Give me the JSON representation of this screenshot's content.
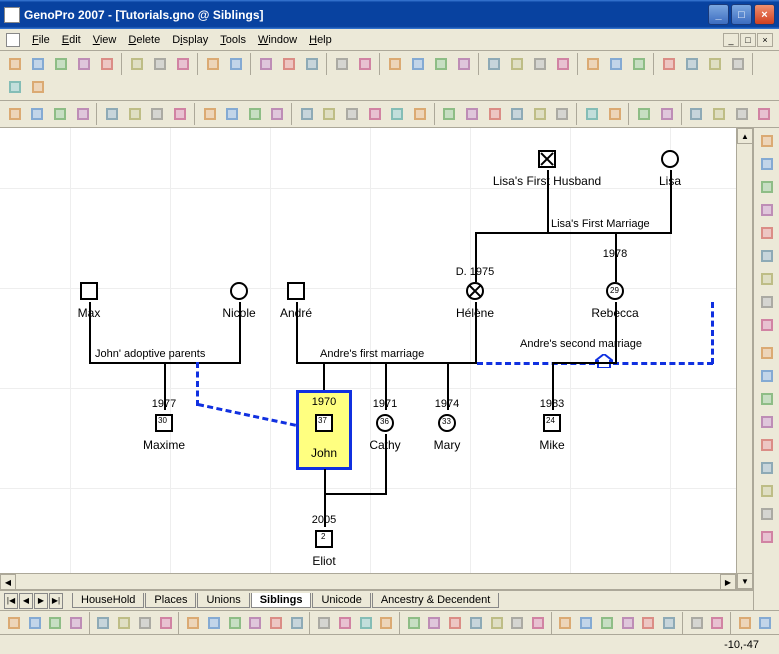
{
  "window": {
    "title": "GenoPro 2007 - [Tutorials.gno @ Siblings]"
  },
  "menu": {
    "items": [
      "File",
      "Edit",
      "View",
      "Delete",
      "Display",
      "Tools",
      "Window",
      "Help"
    ]
  },
  "tabs": {
    "items": [
      "HouseHold",
      "Places",
      "Unions",
      "Siblings",
      "Unicode",
      "Ancestry & Decendent"
    ],
    "active": "Siblings"
  },
  "status": {
    "coords": "-10,-47"
  },
  "people": {
    "lisa_husband": {
      "name": "Lisa's First Husband"
    },
    "lisa": {
      "name": "Lisa"
    },
    "helene": {
      "name": "Hélène",
      "death": "D. 1975"
    },
    "rebecca": {
      "name": "Rebecca",
      "age": "29"
    },
    "max": {
      "name": "Max"
    },
    "nicole": {
      "name": "Nicole"
    },
    "andre": {
      "name": "André"
    },
    "maxime": {
      "name": "Maxime",
      "year": "1977",
      "age": "30"
    },
    "john": {
      "name": "John",
      "year": "1970",
      "age": "37"
    },
    "cathy": {
      "name": "Cathy",
      "year": "1971",
      "age": "36"
    },
    "mary": {
      "name": "Mary",
      "year": "1974",
      "age": "33"
    },
    "mike": {
      "name": "Mike",
      "year": "1983",
      "age": "24"
    },
    "eliot": {
      "name": "Eliot",
      "year": "2005",
      "age": "2"
    }
  },
  "relationships": {
    "lisa_marriage": {
      "label": "Lisa's First Marriage",
      "year": "1978"
    },
    "john_adoptive": {
      "label": "John' adoptive parents"
    },
    "andre_first": {
      "label": "Andre's first marriage"
    },
    "andre_second": {
      "label": "Andre's second marriage"
    }
  },
  "toolbar_icons": [
    "new",
    "open",
    "save",
    "print",
    "print-preview",
    "",
    "cut",
    "copy",
    "paste",
    "",
    "undo",
    "redo",
    "",
    "grid",
    "snap",
    "layers",
    "",
    "zoom-fit",
    "mag",
    "",
    "person-m",
    "person-f",
    "link",
    "chain",
    "",
    "h1",
    "h2",
    "h3",
    "h4",
    "",
    "bolt",
    "tool1",
    "tool2",
    "",
    "text",
    "marker",
    "color",
    "circle",
    "",
    "gear",
    "help"
  ],
  "toolbar2_icons": [
    "nav1",
    "nav2",
    "left",
    "right",
    "",
    "grid1",
    "grid2",
    "grid3",
    "grid4",
    "",
    "zoom-out",
    "zoom-in",
    "zoom-sel",
    "zoom-all",
    "",
    "t1",
    "t2",
    "t3",
    "t4",
    "t5",
    "t6",
    "",
    "t7",
    "t8",
    "t9",
    "t10",
    "t11",
    "t12",
    "",
    "c1",
    "c2",
    "",
    "font-a",
    "font-b",
    "",
    "sw1",
    "sw2",
    "smiley",
    "sw3"
  ],
  "vtoolbar_icons": [
    "v1",
    "v2",
    "v3",
    "v4",
    "v5",
    "v6",
    "v7",
    "v8",
    "v9",
    "",
    "v10",
    "v11",
    "v12",
    "v13",
    "v14",
    "v15",
    "v16",
    "v17",
    "v18"
  ],
  "bottom_icons": [
    "b1",
    "b2",
    "b3",
    "b4",
    "",
    "b5",
    "b6",
    "b7",
    "b8",
    "",
    "b9",
    "b10",
    "b11",
    "b12",
    "b13",
    "b14",
    "",
    "b15",
    "b16",
    "b17",
    "b18",
    "",
    "b19",
    "b20",
    "b21",
    "b22",
    "b23",
    "b24",
    "b25",
    "",
    "b26",
    "b27",
    "b28",
    "b29",
    "b30",
    "b31",
    "",
    "b32",
    "b33",
    "",
    "b34",
    "b35"
  ]
}
